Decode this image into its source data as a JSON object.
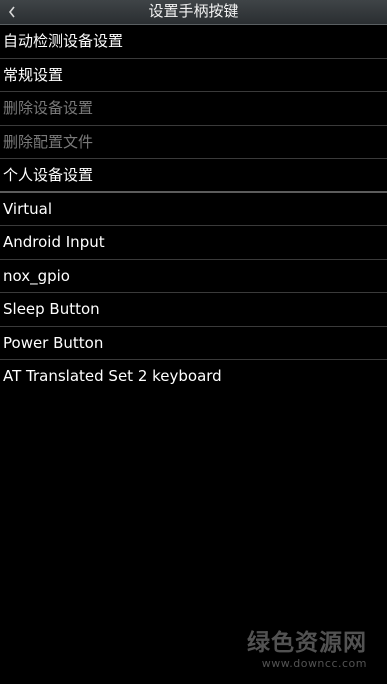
{
  "header": {
    "title": "设置手柄按键",
    "back_icon": "chevron-left-icon"
  },
  "menu": {
    "items": [
      {
        "label": "自动检测设备设置",
        "enabled": true
      },
      {
        "label": "常规设置",
        "enabled": true
      },
      {
        "label": "删除设备设置",
        "enabled": false
      },
      {
        "label": "删除配置文件",
        "enabled": false
      },
      {
        "label": "个人设备设置",
        "enabled": true
      }
    ]
  },
  "devices": {
    "items": [
      {
        "label": "Virtual"
      },
      {
        "label": "Android Input"
      },
      {
        "label": "nox_gpio"
      },
      {
        "label": "Sleep Button"
      },
      {
        "label": "Power Button"
      },
      {
        "label": "AT Translated Set 2 keyboard"
      }
    ]
  },
  "watermark": {
    "logo": "绿色资源网",
    "url": "www.downcc.com"
  },
  "colors": {
    "titlebar": "#33373a",
    "background": "#000000",
    "text": "#ffffff",
    "disabled_text": "#7a7a7a",
    "divider": "#3a3a3a"
  }
}
